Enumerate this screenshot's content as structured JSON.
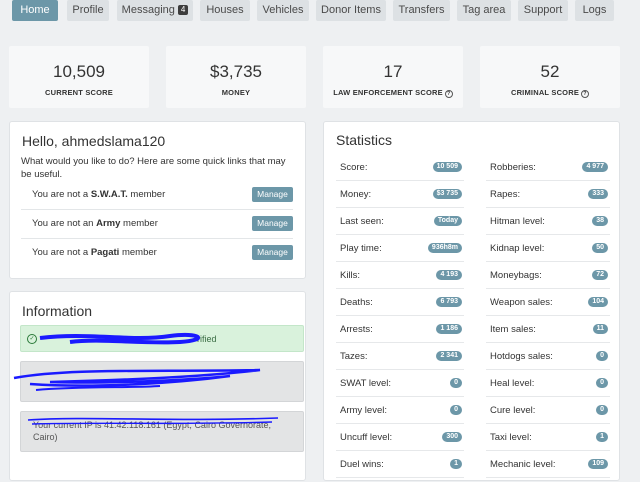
{
  "nav": [
    {
      "label": "Home",
      "active": true
    },
    {
      "label": "Profile"
    },
    {
      "label": "Messaging",
      "badge": "4"
    },
    {
      "label": "Houses"
    },
    {
      "label": "Vehicles"
    },
    {
      "label": "Donor Items"
    },
    {
      "label": "Transfers"
    },
    {
      "label": "Tag area"
    },
    {
      "label": "Support"
    },
    {
      "label": "Logs"
    }
  ],
  "cards": [
    {
      "value": "10,509",
      "label": "CURRENT SCORE"
    },
    {
      "value": "$3,735",
      "label": "MONEY"
    },
    {
      "value": "17",
      "label": "LAW ENFORCEMENT SCORE",
      "help": true
    },
    {
      "value": "52",
      "label": "CRIMINAL SCORE",
      "help": true
    }
  ],
  "hello": {
    "title": "Hello, ahmedslama120",
    "subtitle": "What would you like to do? Here are some quick links that may be useful.",
    "manage_label": "Manage",
    "memberships": [
      {
        "prefix": "You are not a ",
        "group": "S.W.A.T.",
        "suffix": " member"
      },
      {
        "prefix": "You are not an ",
        "group": "Army",
        "suffix": " member"
      },
      {
        "prefix": "You are not a ",
        "group": "Pagati",
        "suffix": " member"
      }
    ]
  },
  "information": {
    "title": "Information",
    "verified_text": "rified",
    "ip_text": "Your current IP is 41.42.118.161 (Egypt, Cairo Governorate, Cairo)"
  },
  "statistics": {
    "title": "Statistics",
    "left": [
      {
        "label": "Score:",
        "value": "10 509"
      },
      {
        "label": "Money:",
        "value": "$3 735"
      },
      {
        "label": "Last seen:",
        "value": "Today"
      },
      {
        "label": "Play time:",
        "value": "936h8m"
      },
      {
        "label": "Kills:",
        "value": "4 193"
      },
      {
        "label": "Deaths:",
        "value": "6 793"
      },
      {
        "label": "Arrests:",
        "value": "1 186"
      },
      {
        "label": "Tazes:",
        "value": "2 341"
      },
      {
        "label": "SWAT level:",
        "value": "0"
      },
      {
        "label": "Army level:",
        "value": "0"
      },
      {
        "label": "Uncuff level:",
        "value": "300"
      },
      {
        "label": "Duel wins:",
        "value": "1"
      }
    ],
    "right": [
      {
        "label": "Robberies:",
        "value": "4 977"
      },
      {
        "label": "Rapes:",
        "value": "333"
      },
      {
        "label": "Hitman level:",
        "value": "38"
      },
      {
        "label": "Kidnap level:",
        "value": "50"
      },
      {
        "label": "Moneybags:",
        "value": "72"
      },
      {
        "label": "Weapon sales:",
        "value": "104"
      },
      {
        "label": "Item sales:",
        "value": "11"
      },
      {
        "label": "Hotdogs sales:",
        "value": "0"
      },
      {
        "label": "Heal level:",
        "value": "0"
      },
      {
        "label": "Cure level:",
        "value": "0"
      },
      {
        "label": "Taxi level:",
        "value": "1"
      },
      {
        "label": "Mechanic level:",
        "value": "109"
      }
    ]
  },
  "colors": {
    "accent": "#6c97a8",
    "background": "#eef0f2",
    "redaction": "#1a1aff"
  }
}
